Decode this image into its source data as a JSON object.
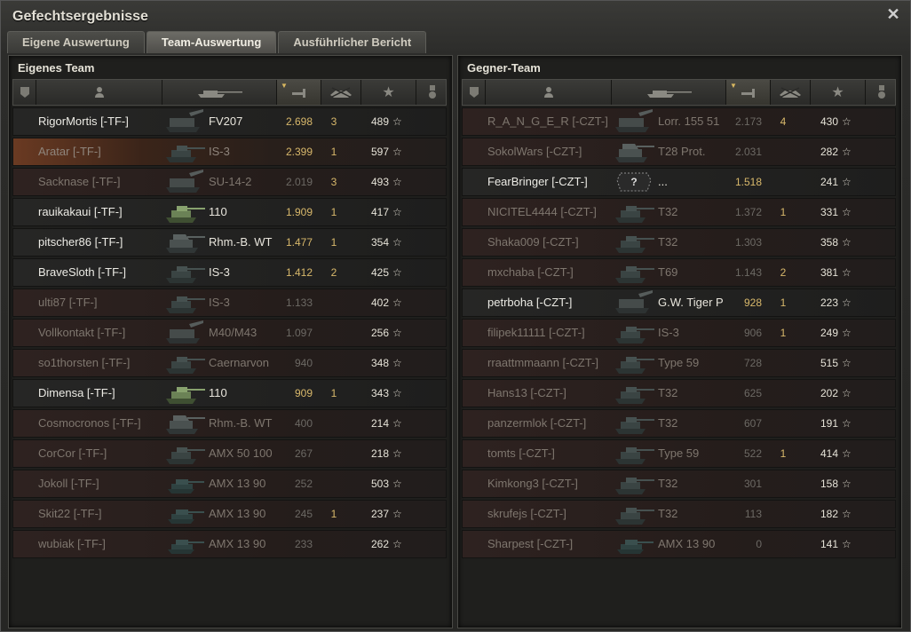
{
  "window": {
    "title": "Gefechtsergebnisse"
  },
  "tabs": [
    {
      "label": "Eigene Auswertung",
      "active": false
    },
    {
      "label": "Team-Auswertung",
      "active": true
    },
    {
      "label": "Ausführlicher Bericht",
      "active": false
    }
  ],
  "colors": {
    "accent": "#d8b86b",
    "row_dead": "#2e2220",
    "row_highlight": "#6a3a22"
  },
  "left": {
    "title": "Eigenes Team",
    "rows": [
      {
        "name": "RigorMortis [-TF-]",
        "vehicle": "FV207",
        "damage": "2.698",
        "kills": "3",
        "xp": "489",
        "state": "alive",
        "tank": "spg"
      },
      {
        "name": "Aratar [-TF-]",
        "vehicle": "IS-3",
        "damage": "2.399",
        "kills": "1",
        "xp": "597",
        "state": "highlight",
        "tank": "heavy"
      },
      {
        "name": "Sacknase [-TF-]",
        "vehicle": "SU-14-2",
        "damage": "2.019",
        "kills": "3",
        "xp": "493",
        "state": "dead",
        "tank": "spg"
      },
      {
        "name": "rauikakaui [-TF-]",
        "vehicle": "110",
        "damage": "1.909",
        "kills": "1",
        "xp": "417",
        "state": "alive",
        "tank": "green"
      },
      {
        "name": "pitscher86 [-TF-]",
        "vehicle": "Rhm.-B. WT",
        "damage": "1.477",
        "kills": "1",
        "xp": "354",
        "state": "alive",
        "tank": "td"
      },
      {
        "name": "BraveSloth [-TF-]",
        "vehicle": "IS-3",
        "damage": "1.412",
        "kills": "2",
        "xp": "425",
        "state": "alive",
        "tank": "heavy"
      },
      {
        "name": "ulti87 [-TF-]",
        "vehicle": "IS-3",
        "damage": "1.133",
        "kills": "",
        "xp": "402",
        "state": "dead",
        "tank": "heavy"
      },
      {
        "name": "Vollkontakt [-TF-]",
        "vehicle": "M40/M43",
        "damage": "1.097",
        "kills": "",
        "xp": "256",
        "state": "dead",
        "tank": "spg"
      },
      {
        "name": "so1thorsten [-TF-]",
        "vehicle": "Caernarvon",
        "damage": "940",
        "kills": "",
        "xp": "348",
        "state": "dead",
        "tank": "heavy"
      },
      {
        "name": "Dimensa [-TF-]",
        "vehicle": "110",
        "damage": "909",
        "kills": "1",
        "xp": "343",
        "state": "alive",
        "tank": "green"
      },
      {
        "name": "Cosmocronos [-TF-]",
        "vehicle": "Rhm.-B. WT",
        "damage": "400",
        "kills": "",
        "xp": "214",
        "state": "dead",
        "tank": "td"
      },
      {
        "name": "CorCor [-TF-]",
        "vehicle": "AMX 50 100",
        "damage": "267",
        "kills": "",
        "xp": "218",
        "state": "dead",
        "tank": "heavy"
      },
      {
        "name": "Jokoll [-TF-]",
        "vehicle": "AMX 13 90",
        "damage": "252",
        "kills": "",
        "xp": "503",
        "state": "dead",
        "tank": "light"
      },
      {
        "name": "Skit22 [-TF-]",
        "vehicle": "AMX 13 90",
        "damage": "245",
        "kills": "1",
        "xp": "237",
        "state": "dead",
        "tank": "light"
      },
      {
        "name": "wubiak [-TF-]",
        "vehicle": "AMX 13 90",
        "damage": "233",
        "kills": "",
        "xp": "262",
        "state": "dead",
        "tank": "light"
      }
    ]
  },
  "right": {
    "title": "Gegner-Team",
    "rows": [
      {
        "name": "R_A_N_G_E_R [-CZT-]",
        "vehicle": "Lorr. 155 51",
        "damage": "2.173",
        "kills": "4",
        "xp": "430",
        "state": "dead",
        "tank": "spg"
      },
      {
        "name": "SokolWars [-CZT-]",
        "vehicle": "T28 Prot.",
        "damage": "2.031",
        "kills": "",
        "xp": "282",
        "state": "dead",
        "tank": "td"
      },
      {
        "name": "FearBringer [-CZT-]",
        "vehicle": "...",
        "damage": "1.518",
        "kills": "",
        "xp": "241",
        "state": "alive",
        "tank": "unknown"
      },
      {
        "name": "NICITEL4444 [-CZT-]",
        "vehicle": "T32",
        "damage": "1.372",
        "kills": "1",
        "xp": "331",
        "state": "dead",
        "tank": "heavy"
      },
      {
        "name": "Shaka009 [-CZT-]",
        "vehicle": "T32",
        "damage": "1.303",
        "kills": "",
        "xp": "358",
        "state": "dead",
        "tank": "heavy"
      },
      {
        "name": "mxchaba [-CZT-]",
        "vehicle": "T69",
        "damage": "1.143",
        "kills": "2",
        "xp": "381",
        "state": "dead",
        "tank": "heavy"
      },
      {
        "name": "petrboha [-CZT-]",
        "vehicle": "G.W. Tiger P",
        "damage": "928",
        "kills": "1",
        "xp": "223",
        "state": "alive",
        "tank": "spg"
      },
      {
        "name": "filipek11111 [-CZT-]",
        "vehicle": "IS-3",
        "damage": "906",
        "kills": "1",
        "xp": "249",
        "state": "dead",
        "tank": "heavy"
      },
      {
        "name": "rraattmmaann [-CZT-]",
        "vehicle": "Type 59",
        "damage": "728",
        "kills": "",
        "xp": "515",
        "state": "dead",
        "tank": "heavy"
      },
      {
        "name": "Hans13 [-CZT-]",
        "vehicle": "T32",
        "damage": "625",
        "kills": "",
        "xp": "202",
        "state": "dead",
        "tank": "heavy"
      },
      {
        "name": "panzermlok [-CZT-]",
        "vehicle": "T32",
        "damage": "607",
        "kills": "",
        "xp": "191",
        "state": "dead",
        "tank": "heavy"
      },
      {
        "name": "tomts [-CZT-]",
        "vehicle": "Type 59",
        "damage": "522",
        "kills": "1",
        "xp": "414",
        "state": "dead",
        "tank": "heavy"
      },
      {
        "name": "Kimkong3 [-CZT-]",
        "vehicle": "T32",
        "damage": "301",
        "kills": "",
        "xp": "158",
        "state": "dead",
        "tank": "heavy"
      },
      {
        "name": "skrufejs [-CZT-]",
        "vehicle": "T32",
        "damage": "113",
        "kills": "",
        "xp": "182",
        "state": "dead",
        "tank": "heavy"
      },
      {
        "name": "Sharpest [-CZT-]",
        "vehicle": "AMX 13 90",
        "damage": "0",
        "kills": "",
        "xp": "141",
        "state": "dead",
        "tank": "light"
      }
    ]
  }
}
